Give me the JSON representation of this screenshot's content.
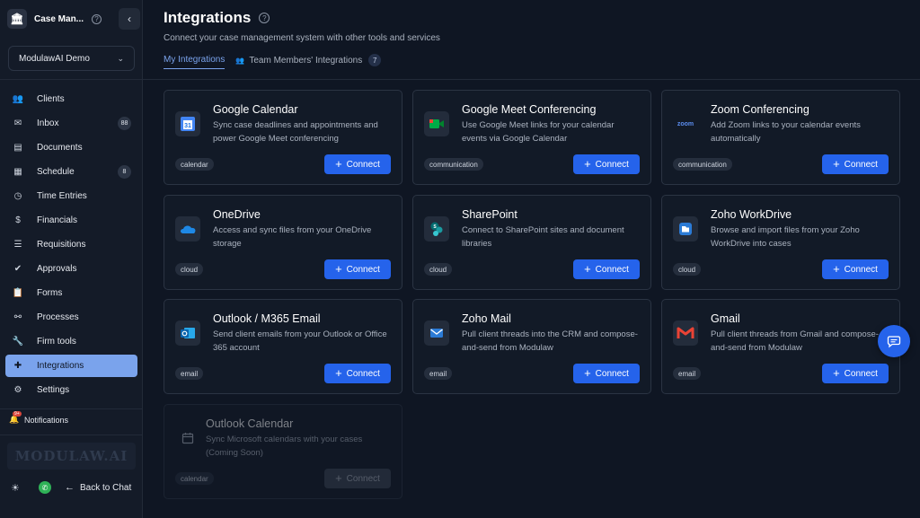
{
  "sidebar": {
    "app_name": "Case Man...",
    "logo_glyph": "🏛",
    "workspace": "ModulawAI Demo",
    "brand_mark": "MODULAW.AI",
    "items": [
      {
        "label": "Clients",
        "icon": "users-icon"
      },
      {
        "label": "Inbox",
        "icon": "mail-icon",
        "badge": "88"
      },
      {
        "label": "Documents",
        "icon": "document-icon"
      },
      {
        "label": "Schedule",
        "icon": "calendar-icon",
        "badge": "8"
      },
      {
        "label": "Time Entries",
        "icon": "clock-icon"
      },
      {
        "label": "Financials",
        "icon": "dollar-icon"
      },
      {
        "label": "Requisitions",
        "icon": "list-icon"
      },
      {
        "label": "Approvals",
        "icon": "inbox-check-icon"
      },
      {
        "label": "Forms",
        "icon": "clipboard-icon"
      },
      {
        "label": "Processes",
        "icon": "workflow-icon"
      },
      {
        "label": "Firm tools",
        "icon": "wrench-icon"
      },
      {
        "label": "Integrations",
        "icon": "puzzle-icon",
        "active": true
      },
      {
        "label": "Settings",
        "icon": "gear-icon"
      }
    ],
    "notifications": {
      "label": "Notifications",
      "badge": "9+"
    },
    "footer": {
      "back_label": "Back to Chat"
    }
  },
  "page": {
    "title": "Integrations",
    "subtitle": "Connect your case management system with other tools and services",
    "tabs": [
      {
        "label": "My Integrations",
        "active": true
      },
      {
        "label": "Team Members' Integrations",
        "count": "7"
      }
    ]
  },
  "cards": [
    {
      "title": "Google Calendar",
      "desc": "Sync case deadlines and appointments and power Google Meet conferencing",
      "tag": "calendar",
      "button": "Connect",
      "icon": "google-calendar-icon"
    },
    {
      "title": "Google Meet Conferencing",
      "desc": "Use Google Meet links for your calendar events via Google Calendar",
      "tag": "communication",
      "button": "Connect",
      "icon": "google-meet-icon"
    },
    {
      "title": "Zoom Conferencing",
      "desc": "Add Zoom links to your calendar events automatically",
      "tag": "communication",
      "button": "Connect",
      "icon": "zoom-icon",
      "icon_text": "zoom"
    },
    {
      "title": "OneDrive",
      "desc": "Access and sync files from your OneDrive storage",
      "tag": "cloud",
      "button": "Connect",
      "icon": "onedrive-icon"
    },
    {
      "title": "SharePoint",
      "desc": "Connect to SharePoint sites and document libraries",
      "tag": "cloud",
      "button": "Connect",
      "icon": "sharepoint-icon"
    },
    {
      "title": "Zoho WorkDrive",
      "desc": "Browse and import files from your Zoho WorkDrive into cases",
      "tag": "cloud",
      "button": "Connect",
      "icon": "zoho-workdrive-icon"
    },
    {
      "title": "Outlook / M365 Email",
      "desc": "Send client emails from your Outlook or Office 365 account",
      "tag": "email",
      "button": "Connect",
      "icon": "outlook-icon"
    },
    {
      "title": "Zoho Mail",
      "desc": "Pull client threads into the CRM and compose-and-send from Modulaw",
      "tag": "email",
      "button": "Connect",
      "icon": "zoho-mail-icon"
    },
    {
      "title": "Gmail",
      "desc": "Pull client threads from Gmail and compose-and-send from Modulaw",
      "tag": "email",
      "button": "Connect",
      "icon": "gmail-icon"
    },
    {
      "title": "Outlook Calendar",
      "desc": "Sync Microsoft calendars with your cases (Coming Soon)",
      "tag": "calendar",
      "button": "Connect",
      "icon": "calendar-icon",
      "disabled": true
    }
  ],
  "colors": {
    "accent": "#2563eb",
    "active_nav": "#7aa3ec",
    "background": "#0f1623"
  }
}
